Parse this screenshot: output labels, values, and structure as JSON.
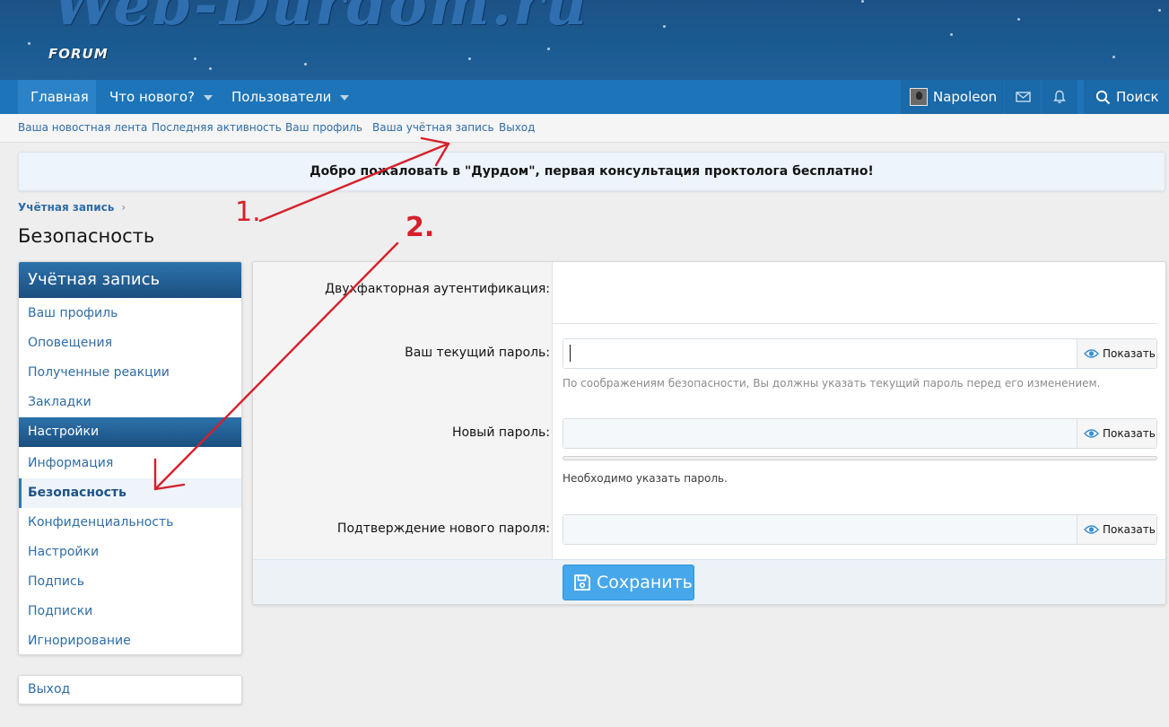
{
  "header": {
    "forum_label": "FORUM"
  },
  "nav": {
    "tabs": [
      {
        "label": "Главная"
      },
      {
        "label": "Что нового?"
      },
      {
        "label": "Пользователи"
      }
    ],
    "user_name": "Napoleon",
    "search_label": "Поиск",
    "icons": [
      "mail-icon",
      "bell-icon",
      "search-icon"
    ]
  },
  "subnav": {
    "links": [
      {
        "label": "Ваша новостная лента"
      },
      {
        "label": "Последняя активность"
      },
      {
        "label": "Ваш профиль"
      },
      {
        "label": "Ваша учётная запись"
      },
      {
        "label": "Выход"
      }
    ]
  },
  "notice": {
    "text": "Добро пожаловать в \"Дурдом\", первая консультация проктолога бесплатно!"
  },
  "breadcrumb": {
    "item": "Учётная запись"
  },
  "page": {
    "title": "Безопасность"
  },
  "sidebar": {
    "heading": "Учётная запись",
    "group1": [
      {
        "label": "Ваш профиль"
      },
      {
        "label": "Оповещения"
      },
      {
        "label": "Полученные реакции"
      },
      {
        "label": "Закладки"
      }
    ],
    "subheading": "Настройки",
    "group2": [
      {
        "label": "Информация"
      },
      {
        "label": "Безопасность"
      },
      {
        "label": "Конфиденциальность"
      },
      {
        "label": "Настройки"
      },
      {
        "label": "Подпись"
      },
      {
        "label": "Подписки"
      },
      {
        "label": "Игнорирование"
      }
    ],
    "selected": "Безопасность",
    "exit_label": "Выход"
  },
  "form": {
    "two_factor_label": "Двухфакторная аутентификация:",
    "current_password_label": "Ваш текущий пароль:",
    "current_password_hint": "По соображениям безопасности, Вы должны указать текущий пароль перед его изменением.",
    "new_password_label": "Новый пароль:",
    "new_password_hint": "Необходимо указать пароль.",
    "confirm_password_label": "Подтверждение нового пароля:",
    "show_label": "Показать",
    "save_label": "Сохранить"
  },
  "annotations": {
    "step1": "1.",
    "step2": "2.",
    "color": "#d6202a"
  },
  "colors": {
    "nav_bar": "#1e74b8",
    "link": "#2f6da6",
    "button": "#47a7eb"
  }
}
